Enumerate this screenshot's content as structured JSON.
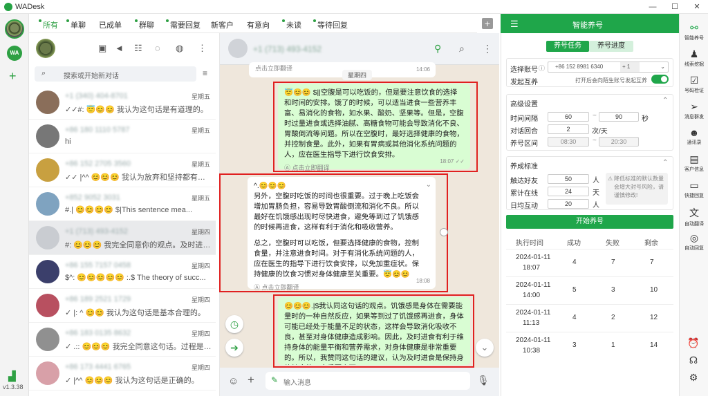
{
  "window": {
    "title": "WADesk",
    "min": "—",
    "max": "☐",
    "close": "✕"
  },
  "version": "v1.3.38",
  "tabs": [
    {
      "label": "所有",
      "dot": true
    },
    {
      "label": "单聊",
      "dot": true
    },
    {
      "label": "已成单",
      "dot": false
    },
    {
      "label": "群聊",
      "dot": true
    },
    {
      "label": "需要回复",
      "dot": true
    },
    {
      "label": "新客户",
      "dot": false
    },
    {
      "label": "有意向",
      "dot": false
    },
    {
      "label": "未读",
      "dot": true
    },
    {
      "label": "等待回复",
      "dot": true
    }
  ],
  "search": {
    "placeholder": "搜索或开始新对话"
  },
  "chats": [
    {
      "name": "+1 (340) 404-8701",
      "date": "星期五",
      "msg": "✓✓#: 😇😊😊 我认为这句话是有道理的。",
      "avatar": "#8a6e5a",
      "sel": false
    },
    {
      "name": "+86 180 1110 5787",
      "date": "星期五",
      "msg": "hi",
      "avatar": "#777777",
      "sel": false
    },
    {
      "name": "+86 152 2705 3560",
      "date": "星期五",
      "msg": "✓✓ |^^ 😊😊😊 我认为放弃和坚持都有其因...",
      "avatar": "#c8a040",
      "sel": false
    },
    {
      "name": "+852 9052 3031",
      "date": "星期五",
      "msg": "#.| 😊😊😊😊 $|This sentence mea...",
      "avatar": "#7fa3c0",
      "sel": false
    },
    {
      "name": "+1 (713) 493-4152",
      "date": "星期四",
      "msg": "#: 😊😊😊 我完全同意你的观点。及时进食...",
      "avatar": "#c9ccd1",
      "sel": true
    },
    {
      "name": "+86 155 7157 0458",
      "date": "星期四",
      "msg": "$^: 😊😊😊😊😊 :.$ The theory of succ...",
      "avatar": "#3b3f6b",
      "sel": false
    },
    {
      "name": "+86 189 2521 1729",
      "date": "星期四",
      "msg": "✓ |: ^ 😊😊 我认为这句话是基本合理的。",
      "avatar": "#b85060",
      "sel": false
    },
    {
      "name": "+86 183 0135 8632",
      "date": "星期四",
      "msg": "✓ .:: 😊😊😊 我完全同意这句话。过程是我...",
      "avatar": "#909090",
      "sel": false
    },
    {
      "name": "+86 173 4441 6765",
      "date": "星期四",
      "msg": "✓ |^^ 😊😊😊 我认为这句话是正确的。",
      "avatar": "#d8a0a8",
      "sel": false
    }
  ],
  "chat_header": {
    "name": "+1 (713) 493-4152"
  },
  "chat": {
    "prev_translate": "点击立即翻译",
    "prev_time": "14:06",
    "day": "星期四",
    "m1": {
      "text": "😇😊😊 $||空腹是可以吃饭的，但是要注意饮食的选择和时间的安排。饿了的时候，可以适当进食一些营养丰富、易消化的食物，如水果、酸奶、坚果等。但是，空腹时过量进食或选择油腻、高糖食物可能会导致消化不良、胃酸倒流等问题。所以在空腹时，最好选择健康的食物，并控制食量。此外，如果有胃病或其他消化系统问题的人，应在医生指导下进行饮食安排。",
      "translate": "点击立即翻译",
      "time": "18:07 ✓✓"
    },
    "m2": {
      "text1": "^.😊😊😊\n另外，空腹时吃饭的时间也很重要。过于晚上吃饭会增加胃肠负担，容易导致胃酸倒流和消化不良。所以最好在饥饿感出现时尽快进食，避免等到过了饥饿感的时候再进食，这样有利于消化和吸收营养。",
      "text2": "总之，空腹时可以吃饭，但要选择健康的食物，控制食量，并注意进食时间。对于有消化系统问题的人，应在医生的指导下进行饮食安排，以免加重症状。保持健康的饮食习惯对身体健康至关重要。😇😊😊",
      "translate": "点击立即翻译",
      "time": "18:08"
    },
    "m3": {
      "text": "😊😊😊.|$我认同这句话的观点。饥饿感是身体在需要能量时的一种自然反应，如果等到过了饥饿感再进食，身体可能已经处于能量不足的状态，这样会导致消化吸收不良，甚至对身体健康造成影响。因此，及时进食有利于维持身体的能量平衡和营养需求，对身体健康是非常重要的。所以，我赞同这句话的建议，认为及时进食是保持身体健康的一个重要方面。"
    }
  },
  "input": {
    "placeholder": "输入消息"
  },
  "panel": {
    "title": "智能养号",
    "tab_active": "养号任务",
    "tab_other": "养号进度",
    "select_label": "选择账号",
    "account": "+86 152 8981 6340",
    "account2": "+ 1",
    "mutual_label": "发起互养",
    "mutual_hint": "打开后会向陌生账号发起互养",
    "adv_title": "高级设置",
    "interval_label": "时间间隔",
    "interval_from": "60",
    "interval_to": "90",
    "interval_unit": "秒",
    "rounds_label": "对话回合",
    "rounds": "2",
    "rounds_unit": "次/天",
    "window_label": "养号区间",
    "window_from": "08:30",
    "window_to": "20:30",
    "std_title": "养成标准",
    "friends_label": "触达好友",
    "friends": "50",
    "friends_unit": "人",
    "online_label": "累计在线",
    "online": "24",
    "online_unit": "天",
    "daily_label": "日均互动",
    "daily": "20",
    "daily_unit": "人",
    "warn": "降低标准的默认数量会增大封号风险，请谨慎修改!",
    "start": "开始养号",
    "headers": [
      "执行时间",
      "成功",
      "失败",
      "剩余"
    ],
    "rows": [
      [
        "2024-01-11",
        "18:07",
        "4",
        "7",
        "7"
      ],
      [
        "2024-01-11",
        "14:00",
        "5",
        "3",
        "10"
      ],
      [
        "2024-01-11",
        "11:13",
        "4",
        "2",
        "12"
      ],
      [
        "2024-01-11",
        "10:38",
        "3",
        "1",
        "14"
      ]
    ]
  },
  "siderail": [
    {
      "icon": "⚯",
      "label": "智能养号",
      "active": true
    },
    {
      "icon": "♟",
      "label": "线索挖掘"
    },
    {
      "icon": "☑",
      "label": "号码检证"
    },
    {
      "icon": "➢",
      "label": "消息群发"
    },
    {
      "icon": "☻",
      "label": "通讯录"
    },
    {
      "icon": "▤",
      "label": "客户信息"
    },
    {
      "icon": "▭",
      "label": "快捷回复"
    },
    {
      "icon": "文",
      "label": "自动翻译"
    },
    {
      "icon": "◎",
      "label": "自动回复"
    }
  ],
  "colors": {
    "green": "#1fa64a",
    "red": "#e02020",
    "bubble_out": "#d9fdd3"
  }
}
